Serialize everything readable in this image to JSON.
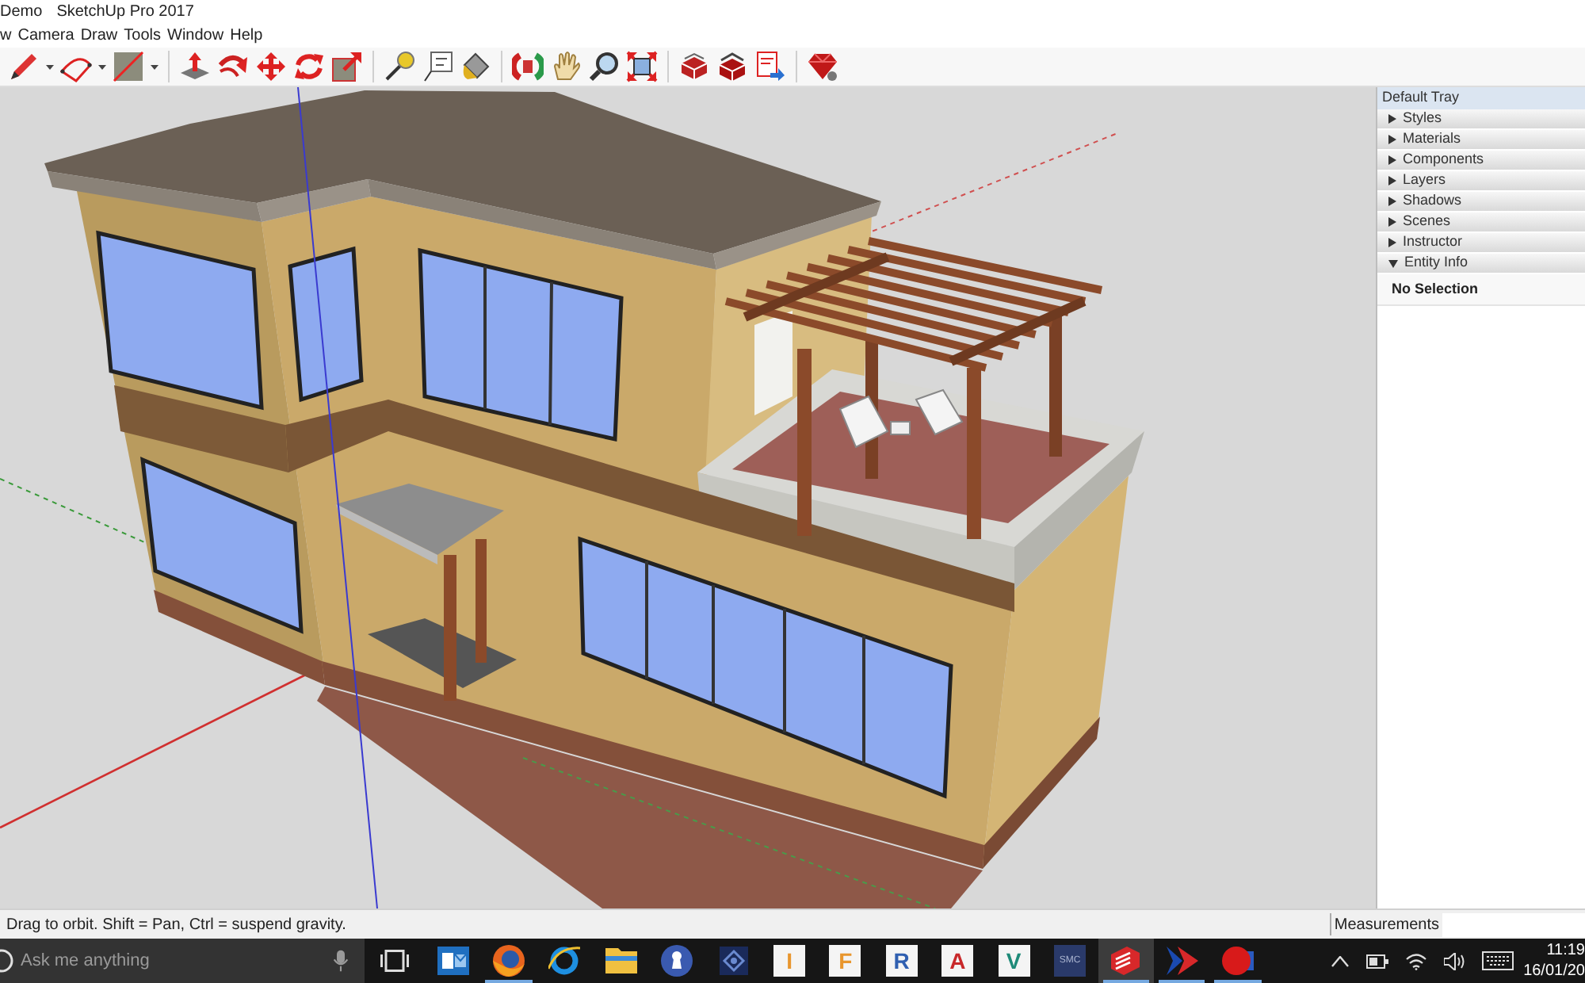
{
  "window": {
    "document": "Demo",
    "app_name": "SketchUp Pro 2017"
  },
  "menu": [
    "w",
    "Camera",
    "Draw",
    "Tools",
    "Window",
    "Help"
  ],
  "tray": {
    "title": "Default Tray",
    "panels": [
      {
        "label": "Styles",
        "expanded": false
      },
      {
        "label": "Materials",
        "expanded": false
      },
      {
        "label": "Components",
        "expanded": false
      },
      {
        "label": "Layers",
        "expanded": false
      },
      {
        "label": "Shadows",
        "expanded": false
      },
      {
        "label": "Scenes",
        "expanded": false
      },
      {
        "label": "Instructor",
        "expanded": false
      },
      {
        "label": "Entity Info",
        "expanded": true,
        "content": "No Selection"
      }
    ]
  },
  "status_bar": {
    "hint": "Drag to orbit. Shift = Pan, Ctrl = suspend gravity.",
    "measurements_label": "Measurements"
  },
  "taskbar": {
    "search": {
      "placeholder": "Ask me anything"
    },
    "apps": [
      {
        "kind": "mail",
        "running": false,
        "active": false
      },
      {
        "kind": "browser",
        "running": true,
        "active": false
      },
      {
        "kind": "ring",
        "running": false,
        "active": false
      },
      {
        "kind": "folder",
        "running": false,
        "active": false
      },
      {
        "kind": "keyhole",
        "running": false,
        "active": false
      },
      {
        "kind": "diamond",
        "running": false,
        "active": false
      },
      {
        "kind": "letter",
        "text": "I",
        "color": "#e8962e",
        "running": false,
        "active": false
      },
      {
        "kind": "letter",
        "text": "F",
        "color": "#e8962e",
        "running": false,
        "active": false
      },
      {
        "kind": "letter",
        "text": "R",
        "color": "#2f5fb0",
        "running": false,
        "active": false
      },
      {
        "kind": "letter",
        "text": "A",
        "color": "#c8282a",
        "running": false,
        "active": false
      },
      {
        "kind": "letter",
        "text": "V",
        "color": "#1e8a78",
        "running": false,
        "active": false
      },
      {
        "kind": "tile",
        "text": "SMC",
        "running": false,
        "active": false
      },
      {
        "kind": "cube",
        "running": true,
        "active": true
      },
      {
        "kind": "chevron",
        "running": true,
        "active": false
      },
      {
        "kind": "circle",
        "running": true,
        "active": false
      }
    ],
    "clock": {
      "time": "11:19",
      "date": "16/01/20"
    }
  }
}
